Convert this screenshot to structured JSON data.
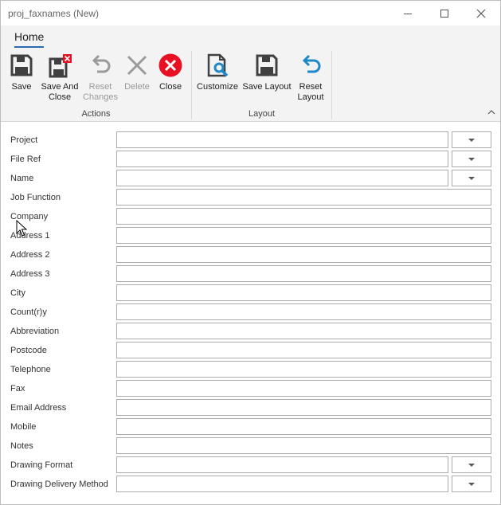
{
  "window": {
    "title": "proj_faxnames (New)"
  },
  "ribbon": {
    "tab": "Home",
    "buttons": {
      "save": "Save",
      "save_and_close_1": "Save And",
      "save_and_close_2": "Close",
      "reset_changes_1": "Reset",
      "reset_changes_2": "Changes",
      "delete": "Delete",
      "close": "Close",
      "customize": "Customize",
      "save_layout": "Save Layout",
      "reset_layout_1": "Reset",
      "reset_layout_2": "Layout"
    },
    "groups": {
      "actions": "Actions",
      "layout": "Layout"
    }
  },
  "fields": {
    "project": "Project",
    "file_ref": "File Ref",
    "name": "Name",
    "job_function": "Job Function",
    "company": "Company",
    "address1": "Address 1",
    "address2": "Address 2",
    "address3": "Address 3",
    "city": "City",
    "country": "Count(r)y",
    "abbreviation": "Abbreviation",
    "postcode": "Postcode",
    "telephone": "Telephone",
    "fax": "Fax",
    "email": "Email Address",
    "mobile": "Mobile",
    "notes": "Notes",
    "drawing_format": "Drawing Format",
    "drawing_delivery": "Drawing Delivery Method"
  },
  "colors": {
    "accent": "#2b6cb0",
    "close_red": "#e81123",
    "customize_blue": "#1e88c8"
  }
}
